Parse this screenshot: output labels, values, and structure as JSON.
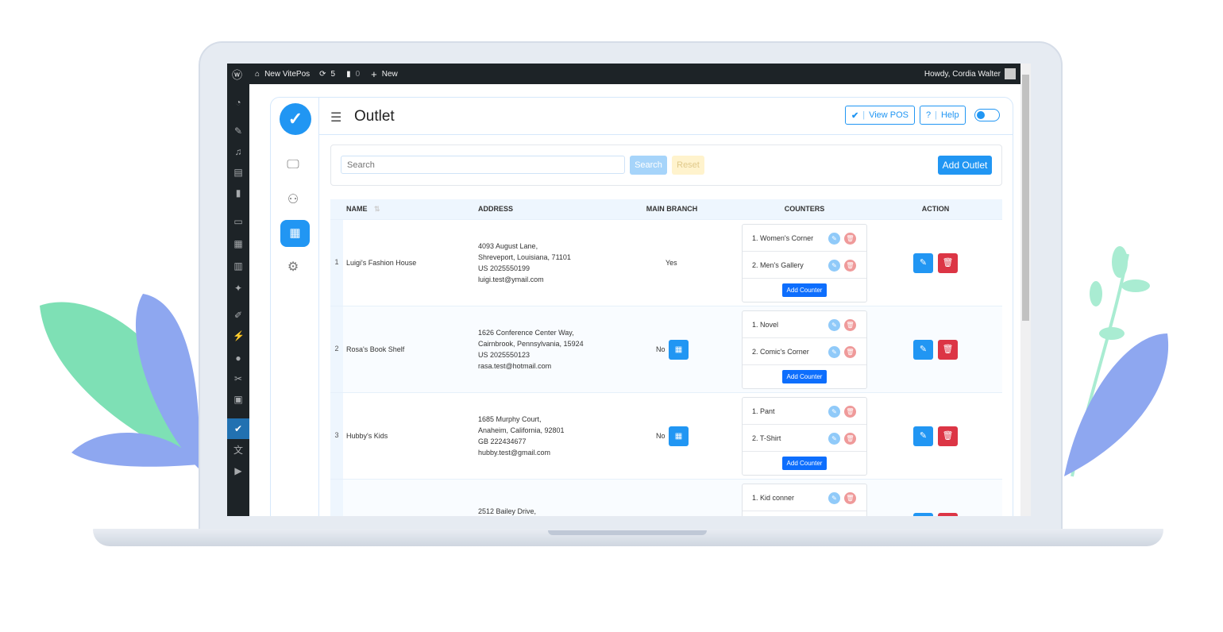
{
  "colors": {
    "primary": "#2196f3",
    "danger": "#dc3545",
    "adminbar": "#1d2327",
    "leaf_green": "#7ee0b5",
    "leaf_blue": "#8ea7f0"
  },
  "adminbar": {
    "site": "New VitePos",
    "updates": "5",
    "comments": "0",
    "new": "New",
    "howdy": "Howdy, Cordia Walter"
  },
  "header": {
    "title": "Outlet",
    "view_pos": "View POS",
    "help": "Help"
  },
  "search": {
    "placeholder": "Search",
    "search_btn": "Search",
    "reset_btn": "Reset",
    "add_outlet": "Add Outlet"
  },
  "table": {
    "columns": [
      "NAME",
      "ADDRESS",
      "MAIN BRANCH",
      "COUNTERS",
      "ACTION"
    ],
    "add_counter": "Add Counter",
    "rows": [
      {
        "index": "1",
        "name": "Luigi's Fashion House",
        "address": [
          "4093 August Lane,",
          "Shreveport, Louisiana, 71101",
          "US 2025550199",
          "luigi.test@ymail.com"
        ],
        "main": "Yes",
        "counters": [
          "1. Women's Corner",
          "2. Men's Gallery"
        ]
      },
      {
        "index": "2",
        "name": "Rosa's Book Shelf",
        "address": [
          "1626 Conference Center Way,",
          "Cairnbrook, Pennsylvania, 15924",
          "US 2025550123",
          "rasa.test@hotmail.com"
        ],
        "main": "No",
        "counters": [
          "1. Novel",
          "2. Comic's Corner"
        ]
      },
      {
        "index": "3",
        "name": "Hubby's Kids",
        "address": [
          "1685 Murphy Court,",
          "Anaheim, California, 92801",
          "GB 222434677",
          "hubby.test@gmail.com"
        ],
        "main": "No",
        "counters": [
          "1. Pant",
          "2. T-Shirt"
        ]
      },
      {
        "index": "",
        "name": "",
        "address": [
          "2512 Bailey Drive,"
        ],
        "main": "",
        "counters": [
          "1. Kid conner"
        ]
      }
    ]
  }
}
